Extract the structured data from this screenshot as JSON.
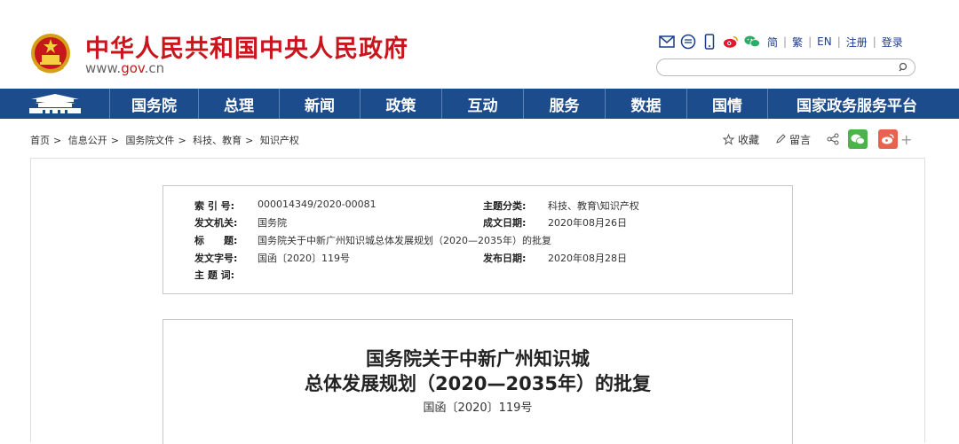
{
  "header": {
    "site_title": "中华人民共和国中央人民政府",
    "site_url_prefix": "www.",
    "site_url_domain": "gov",
    "site_url_suffix": ".cn",
    "tool_icons": [
      "mail-icon",
      "message-icon",
      "mobile-icon",
      "weibo-icon",
      "wechat-icon"
    ],
    "links": [
      "简",
      "繁",
      "EN",
      "注册",
      "登录"
    ],
    "search_placeholder": ""
  },
  "nav": {
    "items": [
      "国务院",
      "总理",
      "新闻",
      "政策",
      "互动",
      "服务",
      "数据",
      "国情",
      "国家政务服务平台"
    ]
  },
  "breadcrumb": [
    "首页",
    "信息公开",
    "国务院文件",
    "科技、教育",
    "知识产权"
  ],
  "share": {
    "favorite": "收藏",
    "comment": "留言"
  },
  "meta": {
    "index_label": "索 引 号:",
    "index_value": "000014349/2020-00081",
    "category_label": "主题分类:",
    "category_value": "科技、教育\\知识产权",
    "issuer_label": "发文机关:",
    "issuer_value": "国务院",
    "written_label": "成文日期:",
    "written_value": "2020年08月26日",
    "title_label": "标　　题:",
    "title_value": "国务院关于中新广州知识城总体发展规划（2020—2035年）的批复",
    "docno_label": "发文字号:",
    "docno_value": "国函〔2020〕119号",
    "publish_label": "发布日期:",
    "publish_value": "2020年08月28日",
    "keywords_label": "主 题 词:",
    "keywords_value": ""
  },
  "article": {
    "title_line1": "国务院关于中新广州知识城",
    "title_line2": "总体发展规划（2020—2035年）的批复",
    "doc_number": "国函〔2020〕119号"
  },
  "colors": {
    "brand_red": "#c8161d",
    "nav_blue": "#1c4c8c",
    "wechat_green": "#4ab34a",
    "weibo_red": "#e8634f"
  }
}
